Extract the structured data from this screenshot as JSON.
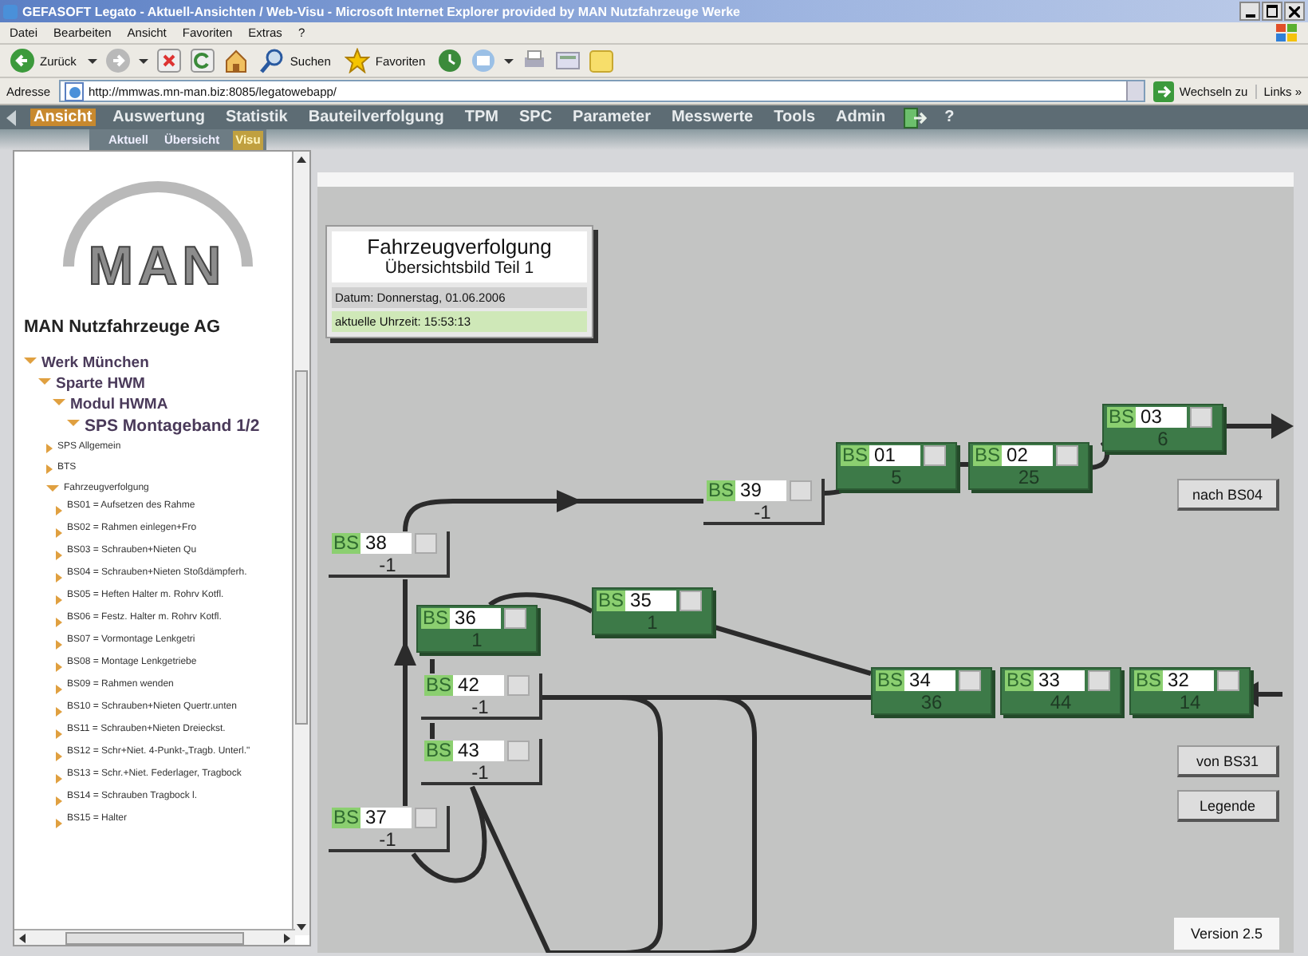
{
  "window": {
    "title": "GEFASOFT Legato - Aktuell-Ansichten / Web-Visu - Microsoft Internet Explorer provided by MAN Nutzfahrzeuge Werke"
  },
  "menu_bar": [
    "Datei",
    "Bearbeiten",
    "Ansicht",
    "Favoriten",
    "Extras",
    "?"
  ],
  "toolbar": {
    "back": "Zurück",
    "search": "Suchen",
    "favorites": "Favoriten"
  },
  "address_bar": {
    "label": "Adresse",
    "value": "http://mmwas.mn-man.biz:8085/legatowebapp/",
    "go": "Wechseln zu",
    "links": "Links »"
  },
  "nav": [
    {
      "kind": "text",
      "label": "Ansicht",
      "selected": true
    },
    {
      "kind": "text",
      "label": "Auswertung",
      "selected": false
    },
    {
      "kind": "text",
      "label": "Statistik",
      "selected": false
    },
    {
      "kind": "text",
      "label": "Bauteilverfolgung",
      "selected": false
    },
    {
      "kind": "text",
      "label": "TPM",
      "selected": false
    },
    {
      "kind": "text",
      "label": "SPC",
      "selected": false
    },
    {
      "kind": "text",
      "label": "Parameter",
      "selected": false
    },
    {
      "kind": "text",
      "label": "Messwerte",
      "selected": false
    },
    {
      "kind": "text",
      "label": "Tools",
      "selected": false
    },
    {
      "kind": "text",
      "label": "Admin",
      "selected": false
    },
    {
      "kind": "icon",
      "selected": false
    },
    {
      "kind": "text",
      "label": "?",
      "selected": false
    }
  ],
  "subnav": [
    {
      "label": "Aktuell",
      "selected": false
    },
    {
      "label": "Übersicht",
      "selected": false
    },
    {
      "label": "Visu",
      "selected": true
    }
  ],
  "sidebar": {
    "logo": "MAN",
    "company": "MAN Nutzfahrzeuge AG",
    "tree": [
      {
        "label": "Werk München",
        "expanded": true,
        "children": [
          {
            "label": "Sparte HWM",
            "expanded": true,
            "children": [
              {
                "label": "Modul HWMA",
                "expanded": true,
                "children": [
                  {
                    "label": "SPS Montageband 1/2",
                    "expanded": true,
                    "children": [
                      {
                        "label": "SPS Allgemein",
                        "expanded": false
                      },
                      {
                        "label": "BTS",
                        "expanded": false
                      },
                      {
                        "label": "Fahrzeugverfolgung",
                        "expanded": true,
                        "children": [
                          {
                            "label": "BS01 = Aufsetzen des Rahme",
                            "expanded": false
                          },
                          {
                            "label": "BS02 = Rahmen einlegen+Fro",
                            "expanded": false
                          },
                          {
                            "label": "BS03 = Schrauben+Nieten Qu",
                            "expanded": false
                          },
                          {
                            "label": "BS04 = Schrauben+Nieten Stoßdämpferh.",
                            "expanded": false
                          },
                          {
                            "label": "BS05 = Heften Halter m. Rohrv Kotfl.",
                            "expanded": false
                          },
                          {
                            "label": "BS06 = Festz. Halter m. Rohrv Kotfl.",
                            "expanded": false
                          },
                          {
                            "label": "BS07 = Vormontage Lenkgetri",
                            "expanded": false
                          },
                          {
                            "label": "BS08 = Montage Lenkgetriebe",
                            "expanded": false
                          },
                          {
                            "label": "BS09 = Rahmen wenden",
                            "expanded": false
                          },
                          {
                            "label": "BS10 = Schrauben+Nieten Quertr.unten",
                            "expanded": false
                          },
                          {
                            "label": "BS11 = Schrauben+Nieten Dreieckst.",
                            "expanded": false
                          },
                          {
                            "label": "BS12 = Schr+Niet. 4-Punkt-„Tragb. Unterl.\"",
                            "expanded": false
                          },
                          {
                            "label": "BS13 = Schr.+Niet. Federlager, Tragbock",
                            "expanded": false
                          },
                          {
                            "label": "BS14 = Schrauben Tragbock l.",
                            "expanded": false
                          },
                          {
                            "label": "BS15 = Halter",
                            "expanded": false
                          }
                        ]
                      }
                    ]
                  }
                ]
              }
            ]
          }
        ]
      }
    ]
  },
  "diagram": {
    "title": "Fahrzeugverfolgung",
    "subtitle": "Übersichtsbild Teil 1",
    "date": "Datum: Donnerstag, 01.06.2006",
    "time": "aktuelle Uhrzeit: 15:53:13",
    "stations": [
      {
        "prefix": "BS",
        "number": "03",
        "count": "6",
        "active": true
      },
      {
        "prefix": "BS",
        "number": "01",
        "count": "5",
        "active": true
      },
      {
        "prefix": "BS",
        "number": "02",
        "count": "25",
        "active": true
      },
      {
        "prefix": "BS",
        "number": "39",
        "count": "-1",
        "active": false
      },
      {
        "prefix": "BS",
        "number": "38",
        "count": "-1",
        "active": false
      },
      {
        "prefix": "BS",
        "number": "35",
        "count": "1",
        "active": true
      },
      {
        "prefix": "BS",
        "number": "36",
        "count": "1",
        "active": true
      },
      {
        "prefix": "BS",
        "number": "42",
        "count": "-1",
        "active": false
      },
      {
        "prefix": "BS",
        "number": "34",
        "count": "36",
        "active": true
      },
      {
        "prefix": "BS",
        "number": "33",
        "count": "44",
        "active": true
      },
      {
        "prefix": "BS",
        "number": "32",
        "count": "14",
        "active": true
      },
      {
        "prefix": "BS",
        "number": "43",
        "count": "-1",
        "active": false
      },
      {
        "prefix": "BS",
        "number": "37",
        "count": "-1",
        "active": false
      }
    ],
    "buttons": [
      "nach BS04",
      "von BS31",
      "Legende"
    ],
    "version": "Version 2.5"
  }
}
